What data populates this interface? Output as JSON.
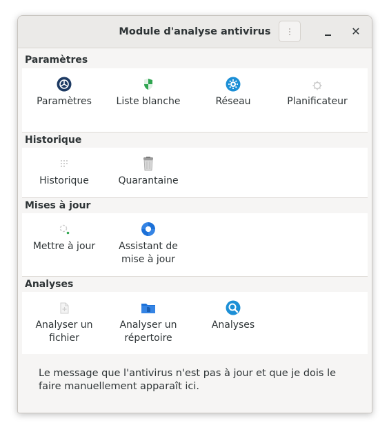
{
  "window": {
    "title": "Module d'analyse antivirus"
  },
  "sections": {
    "settings": {
      "label": "Paramètres",
      "items": [
        {
          "label": "Paramètres",
          "icon": "settings-icon"
        },
        {
          "label": "Liste blanche",
          "icon": "shield-icon"
        },
        {
          "label": "Réseau",
          "icon": "network-icon"
        },
        {
          "label": "Planificateur",
          "icon": "scheduler-icon"
        }
      ]
    },
    "history": {
      "label": "Historique",
      "items": [
        {
          "label": "Historique",
          "icon": "history-icon"
        },
        {
          "label": "Quarantaine",
          "icon": "trash-icon"
        }
      ]
    },
    "updates": {
      "label": "Mises à jour",
      "items": [
        {
          "label": "Mettre à jour",
          "icon": "update-icon"
        },
        {
          "label": "Assistant de\nmise à jour",
          "line1": "Assistant de",
          "line2": "mise à jour",
          "icon": "help-lifebuoy-icon"
        }
      ]
    },
    "scans": {
      "label": "Analyses",
      "items": [
        {
          "label": "Analyser un fichier",
          "line1": "Analyser un",
          "line2": "fichier",
          "icon": "file-icon"
        },
        {
          "label": "Analyser un répertoire",
          "line1": "Analyser un",
          "line2": "répertoire",
          "icon": "folder-icon"
        },
        {
          "label": "Analyses",
          "icon": "search-icon"
        }
      ]
    }
  },
  "status": {
    "message": "Le message que l'antivirus n'est pas à jour et que je dois le faire manuellement apparaît ici."
  },
  "colors": {
    "accent": "#1c71d8",
    "window_bg": "#f6f5f4",
    "panel_bg": "#ffffff"
  }
}
